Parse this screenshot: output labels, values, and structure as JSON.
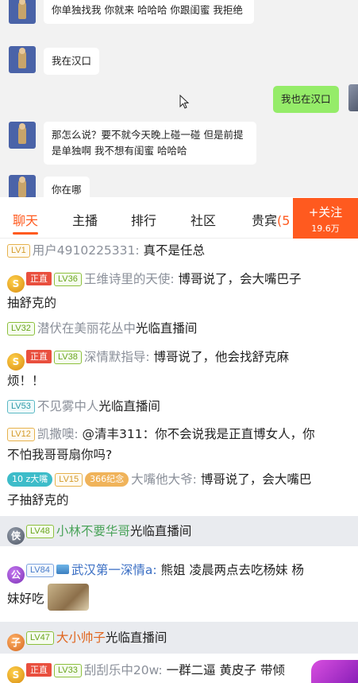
{
  "chat": {
    "messages": [
      {
        "side": "left",
        "text": "你单独找我 你就来 哈哈哈 你跟闺蜜 我拒绝"
      },
      {
        "side": "left",
        "text": "我在汉口"
      },
      {
        "side": "right",
        "text": "我也在汉口"
      },
      {
        "side": "left",
        "text": "那怎么说？要不就今天晚上碰一碰 但是前提是单独啊 我不想有闺蜜 哈哈哈"
      },
      {
        "side": "left",
        "text": "你在哪"
      }
    ]
  },
  "tabs": [
    {
      "label": "聊天",
      "active": true
    },
    {
      "label": "主播"
    },
    {
      "label": "排行"
    },
    {
      "label": "社区"
    },
    {
      "label": "贵宾"
    },
    {
      "label": "(5"
    }
  ],
  "follow": {
    "label": "+关注",
    "count": "19.6万"
  },
  "danmaku": [
    {
      "lv": "LV1",
      "name": "用户4910225331:",
      "text": "真不是任总"
    },
    {
      "badge": "正直",
      "lv": "LV36",
      "name": "王维诗里的天使:",
      "text": "博哥说了，会大嘴巴子",
      "text2": "抽舒克的"
    },
    {
      "lv": "LV32",
      "name": "潜伏在美丽花丛中",
      "text": "光临直播间"
    },
    {
      "badge": "正直",
      "lv": "LV38",
      "name": "深情默指导:",
      "text": "博哥说了，他会找舒克麻",
      "text2": "烦！！"
    },
    {
      "lv": "LV53",
      "name": "不见雾中人",
      "text": "光临直播间"
    },
    {
      "lv": "LV12",
      "name": "凯撒噢:",
      "text": "@清丰311：你不会说我是正直博女人，你",
      "text2": "不怕我哥哥扇你吗?"
    },
    {
      "fan": "10 z大嘴",
      "lv": "LV15",
      "fan2": "366纪念",
      "name": "大嘴他大爷:",
      "text": "博哥说了，会大嘴巴",
      "text2": "子抽舒克的"
    },
    {
      "medal": "侠",
      "lv": "LV48",
      "name": "小林不要华哥",
      "text": "光临直播间"
    },
    {
      "medal": "公",
      "lv": "LV84",
      "name": "武汉第一深情a:",
      "text": "熊姐 凌晨两点去吃杨妹  杨",
      "text2": "妹好吃"
    },
    {
      "medal": "子",
      "lv": "LV47",
      "name": "大小帅子",
      "text": "光临直播间"
    },
    {
      "badge": "正直",
      "lv": "LV33",
      "name": "刮刮乐中20w:",
      "text": "一群二逼 黄皮子 带倾"
    }
  ],
  "colors": {
    "accent": "#ff5a1f",
    "self_bubble": "#95ec69"
  }
}
